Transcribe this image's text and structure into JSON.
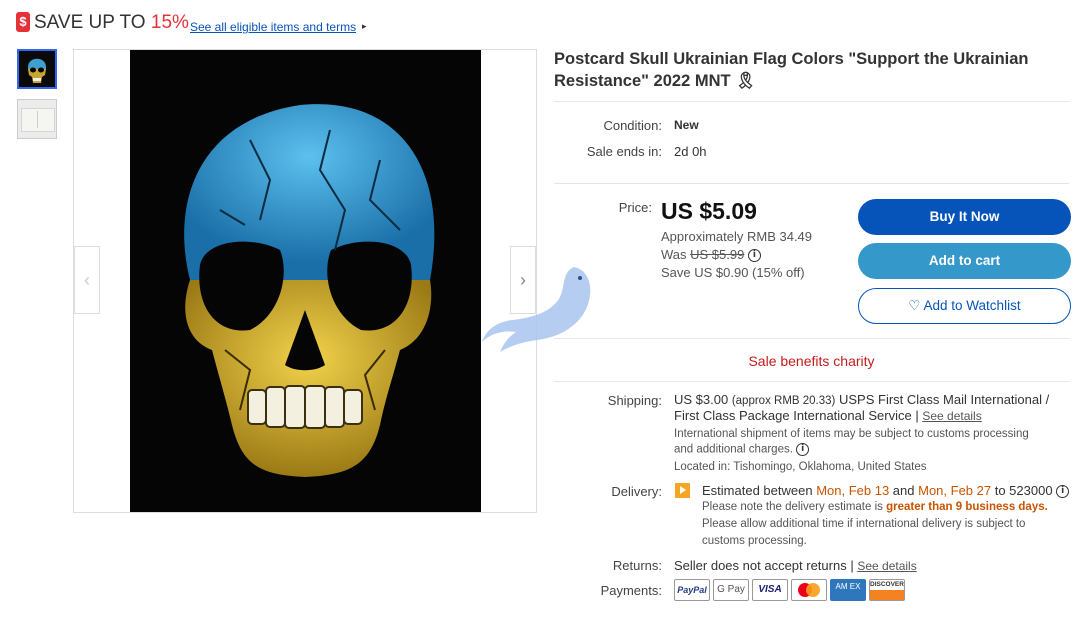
{
  "promo": {
    "tag": "$",
    "save_text": "SAVE UP TO ",
    "percent": "15%",
    "link": "See all eligible items and terms",
    "arrow": "▸"
  },
  "gallery": {
    "prev": "‹",
    "next": "›"
  },
  "item": {
    "title": "Postcard Skull Ukrainian Flag Colors \"Support the Ukrainian Resistance\" 2022 MNT 🎗",
    "condition_label": "Condition:",
    "condition_value": "New",
    "sale_label": "Sale ends in:",
    "sale_value": "2d 0h"
  },
  "pricing": {
    "label": "Price:",
    "price": "US $5.09",
    "approx": "Approximately RMB 34.49",
    "was_label": "Was ",
    "was_value": "US $5.99",
    "save": "Save US $0.90 (15% off)",
    "info": "i"
  },
  "actions": {
    "buy": "Buy It Now",
    "cart": "Add to cart",
    "watch_icon": "♡",
    "watch": "Add to Watchlist"
  },
  "charity": "Sale benefits charity",
  "shipping": {
    "label": "Shipping:",
    "price": "US $3.00",
    "approx": "(approx RMB 20.33)",
    "service": "USPS First Class Mail International /",
    "service2": "First Class Package International Service |",
    "details": "See details",
    "note1": "International shipment of items may be subject to customs processing",
    "note2": "and additional charges.",
    "location": "Located in: Tishomingo, Oklahoma, United States"
  },
  "delivery": {
    "label": "Delivery:",
    "prefix": "Estimated between ",
    "date1": "Mon, Feb 13",
    "and": " and ",
    "date2": "Mon, Feb 27",
    "suffix": " to 523000",
    "note_prefix": "Please note the delivery estimate is ",
    "note_em": "greater than 9 business days.",
    "note2": "Please allow additional time if international delivery is subject to",
    "note3": "customs processing."
  },
  "returns": {
    "label": "Returns:",
    "text": "Seller does not accept returns |",
    "details": "See details"
  },
  "payments": {
    "label": "Payments:",
    "methods": [
      "PayPal",
      "G Pay",
      "VISA",
      "",
      "AM EX",
      "DISCOVER"
    ]
  },
  "colors": {
    "primary_blue": "#0654ba",
    "cart_blue": "#3498ca",
    "promo_red": "#e53238",
    "charity_red": "#c41c1c",
    "orange": "#c95400"
  }
}
